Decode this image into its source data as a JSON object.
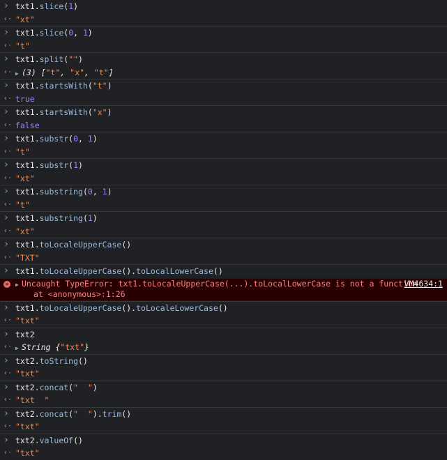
{
  "prompt_symbol": ">",
  "result_symbol": "<·",
  "error_icon": "x-circle-icon",
  "colors": {
    "background": "#202124",
    "function": "#9bbbdc",
    "string": "#f28b54",
    "number_boolean": "#9980ff",
    "error_text": "#ff8080",
    "error_background": "#290000"
  },
  "entries": [
    {
      "type": "input",
      "tokens": [
        [
          "txt1.",
          "plain"
        ],
        [
          "slice",
          "fn"
        ],
        [
          "(",
          "plain"
        ],
        [
          "1",
          "num"
        ],
        [
          ")",
          "plain"
        ]
      ]
    },
    {
      "type": "output",
      "tokens": [
        [
          "\"xt\"",
          "str"
        ]
      ]
    },
    {
      "type": "input",
      "tokens": [
        [
          "txt1.",
          "plain"
        ],
        [
          "slice",
          "fn"
        ],
        [
          "(",
          "plain"
        ],
        [
          "0",
          "num"
        ],
        [
          ", ",
          "plain"
        ],
        [
          "1",
          "num"
        ],
        [
          ")",
          "plain"
        ]
      ]
    },
    {
      "type": "output",
      "tokens": [
        [
          "\"t\"",
          "str"
        ]
      ]
    },
    {
      "type": "input",
      "tokens": [
        [
          "txt1.",
          "plain"
        ],
        [
          "split",
          "fn"
        ],
        [
          "(",
          "plain"
        ],
        [
          "\"\"",
          "str"
        ],
        [
          ")",
          "plain"
        ]
      ]
    },
    {
      "type": "output",
      "expandable": true,
      "tokens": [
        [
          "(3) [",
          "obj"
        ],
        [
          "\"t\"",
          "str"
        ],
        [
          ", ",
          "obj"
        ],
        [
          "\"x\"",
          "str"
        ],
        [
          ", ",
          "obj"
        ],
        [
          "\"t\"",
          "str"
        ],
        [
          "]",
          "obj"
        ]
      ]
    },
    {
      "type": "input",
      "tokens": [
        [
          "txt1.",
          "plain"
        ],
        [
          "startsWith",
          "fn"
        ],
        [
          "(",
          "plain"
        ],
        [
          "\"t\"",
          "str"
        ],
        [
          ")",
          "plain"
        ]
      ]
    },
    {
      "type": "output",
      "tokens": [
        [
          "true",
          "bool"
        ]
      ]
    },
    {
      "type": "input",
      "tokens": [
        [
          "txt1.",
          "plain"
        ],
        [
          "startsWith",
          "fn"
        ],
        [
          "(",
          "plain"
        ],
        [
          "\"x\"",
          "str"
        ],
        [
          ")",
          "plain"
        ]
      ]
    },
    {
      "type": "output",
      "tokens": [
        [
          "false",
          "bool"
        ]
      ]
    },
    {
      "type": "input",
      "tokens": [
        [
          "txt1.",
          "plain"
        ],
        [
          "substr",
          "fn"
        ],
        [
          "(",
          "plain"
        ],
        [
          "0",
          "num"
        ],
        [
          ", ",
          "plain"
        ],
        [
          "1",
          "num"
        ],
        [
          ")",
          "plain"
        ]
      ]
    },
    {
      "type": "output",
      "tokens": [
        [
          "\"t\"",
          "str"
        ]
      ]
    },
    {
      "type": "input",
      "tokens": [
        [
          "txt1.",
          "plain"
        ],
        [
          "substr",
          "fn"
        ],
        [
          "(",
          "plain"
        ],
        [
          "1",
          "num"
        ],
        [
          ")",
          "plain"
        ]
      ]
    },
    {
      "type": "output",
      "tokens": [
        [
          "\"xt\"",
          "str"
        ]
      ]
    },
    {
      "type": "input",
      "tokens": [
        [
          "txt1.",
          "plain"
        ],
        [
          "substring",
          "fn"
        ],
        [
          "(",
          "plain"
        ],
        [
          "0",
          "num"
        ],
        [
          ", ",
          "plain"
        ],
        [
          "1",
          "num"
        ],
        [
          ")",
          "plain"
        ]
      ]
    },
    {
      "type": "output",
      "tokens": [
        [
          "\"t\"",
          "str"
        ]
      ]
    },
    {
      "type": "input",
      "tokens": [
        [
          "txt1.",
          "plain"
        ],
        [
          "substring",
          "fn"
        ],
        [
          "(",
          "plain"
        ],
        [
          "1",
          "num"
        ],
        [
          ")",
          "plain"
        ]
      ]
    },
    {
      "type": "output",
      "tokens": [
        [
          "\"xt\"",
          "str"
        ]
      ]
    },
    {
      "type": "input",
      "tokens": [
        [
          "txt1.",
          "plain"
        ],
        [
          "toLocaleUpperCase",
          "fn"
        ],
        [
          "()",
          "plain"
        ]
      ]
    },
    {
      "type": "output",
      "tokens": [
        [
          "\"TXT\"",
          "str"
        ]
      ]
    },
    {
      "type": "input",
      "tokens": [
        [
          "txt1.",
          "plain"
        ],
        [
          "toLocaleUpperCase",
          "fn"
        ],
        [
          "().",
          "plain"
        ],
        [
          "toLocalLowerCase",
          "fn"
        ],
        [
          "()",
          "plain"
        ]
      ]
    },
    {
      "type": "error",
      "message": "Uncaught TypeError: txt1.toLocaleUpperCase(...).toLocalLowerCase is not a function",
      "stack": "at <anonymous>:1:26",
      "source": "VM4634:1"
    },
    {
      "type": "input",
      "tokens": [
        [
          "txt1.",
          "plain"
        ],
        [
          "toLocaleUpperCase",
          "fn"
        ],
        [
          "().",
          "plain"
        ],
        [
          "toLocaleLowerCase",
          "fn"
        ],
        [
          "()",
          "plain"
        ]
      ]
    },
    {
      "type": "output",
      "tokens": [
        [
          "\"txt\"",
          "str"
        ]
      ]
    },
    {
      "type": "input",
      "tokens": [
        [
          "txt2",
          "plain"
        ]
      ]
    },
    {
      "type": "output",
      "expandable": true,
      "tokens": [
        [
          "String {",
          "obj"
        ],
        [
          "\"txt\"",
          "str"
        ],
        [
          "}",
          "obj"
        ]
      ]
    },
    {
      "type": "input",
      "tokens": [
        [
          "txt2.",
          "plain"
        ],
        [
          "toString",
          "fn"
        ],
        [
          "()",
          "plain"
        ]
      ]
    },
    {
      "type": "output",
      "tokens": [
        [
          "\"txt\"",
          "str"
        ]
      ]
    },
    {
      "type": "input",
      "tokens": [
        [
          "txt2.",
          "plain"
        ],
        [
          "concat",
          "fn"
        ],
        [
          "(",
          "plain"
        ],
        [
          "\"  \"",
          "str"
        ],
        [
          ")",
          "plain"
        ]
      ]
    },
    {
      "type": "output",
      "tokens": [
        [
          "\"txt  \"",
          "str"
        ]
      ]
    },
    {
      "type": "input",
      "tokens": [
        [
          "txt2.",
          "plain"
        ],
        [
          "concat",
          "fn"
        ],
        [
          "(",
          "plain"
        ],
        [
          "\"  \"",
          "str"
        ],
        [
          ").",
          "plain"
        ],
        [
          "trim",
          "fn"
        ],
        [
          "()",
          "plain"
        ]
      ]
    },
    {
      "type": "output",
      "tokens": [
        [
          "\"txt\"",
          "str"
        ]
      ]
    },
    {
      "type": "input",
      "tokens": [
        [
          "txt2.",
          "plain"
        ],
        [
          "valueOf",
          "fn"
        ],
        [
          "()",
          "plain"
        ]
      ]
    },
    {
      "type": "output",
      "tokens": [
        [
          "\"txt\"",
          "str"
        ]
      ]
    }
  ]
}
